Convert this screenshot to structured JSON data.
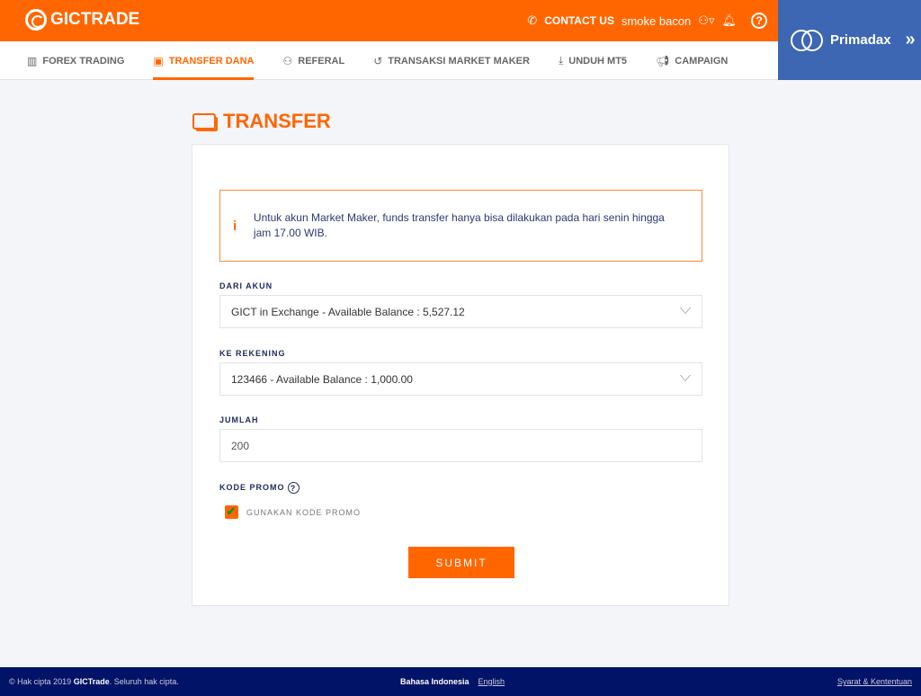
{
  "header": {
    "logo": "GICTRADE",
    "contact": "CONTACT US",
    "user": "smoke bacon",
    "help": "?",
    "partner": "Primadax"
  },
  "nav": [
    {
      "label": "FOREX TRADING",
      "icon": "bar-chart-icon"
    },
    {
      "label": "TRANSFER DANA",
      "icon": "money-icon",
      "active": true
    },
    {
      "label": "REFERAL",
      "icon": "user-add-icon"
    },
    {
      "label": "TRANSAKSI MARKET MAKER",
      "icon": "history-icon"
    },
    {
      "label": "UNDUH MT5",
      "icon": "download-icon"
    },
    {
      "label": "CAMPAIGN",
      "icon": "megaphone-icon"
    }
  ],
  "page": {
    "title": "TRANSFER"
  },
  "form": {
    "alert": "Untuk akun Market Maker, funds transfer hanya bisa dilakukan pada hari senin hingga jam 17.00 WIB.",
    "from_label": "DARI AKUN",
    "from_value": "GICT in Exchange - Available Balance : 5,527.12",
    "to_label": "KE REKENING",
    "to_value": "123466 - Available Balance : 1,000.00",
    "amount_label": "JUMLAH",
    "amount_value": "200",
    "promo_label": "KODE PROMO",
    "promo_checkbox": "GUNAKAN KODE PROMO",
    "promo_checked": true,
    "submit": "SUBMIT"
  },
  "footer": {
    "copyright_pre": "© Hak cipta 2019",
    "brand": "GICTrade",
    "copyright_post": ". Seluruh hak cipta.",
    "lang_active": "Bahasa Indonesia",
    "lang_other": "English",
    "terms": "Syarat & Kententuan"
  },
  "colors": {
    "accent": "#ff6600",
    "partner": "#3d66b3",
    "footer": "#001366"
  }
}
